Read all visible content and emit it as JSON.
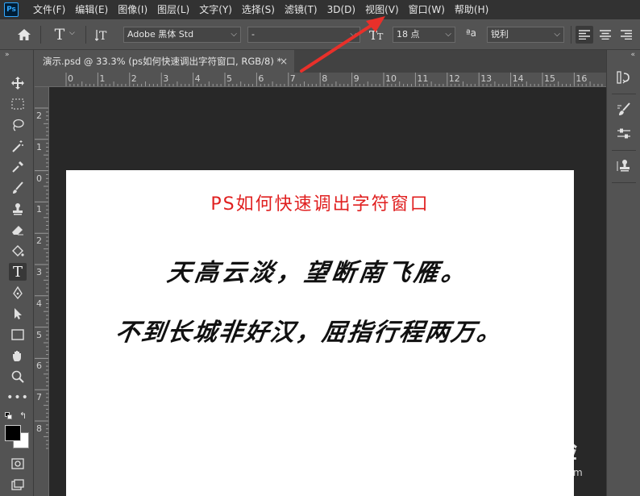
{
  "app": {
    "logo": "Ps"
  },
  "menu": [
    "文件(F)",
    "编辑(E)",
    "图像(I)",
    "图层(L)",
    "文字(Y)",
    "选择(S)",
    "滤镜(T)",
    "3D(D)",
    "视图(V)",
    "窗口(W)",
    "帮助(H)"
  ],
  "options": {
    "font_family": "Adobe 黑体 Std",
    "font_style": "-",
    "font_size": "18 点",
    "aa_label": "ªa",
    "anti_alias": "锐利"
  },
  "tab": {
    "title": "演示.psd @ 33.3% (ps如何快速调出字符窗口, RGB/8) *",
    "close": "×"
  },
  "rulers": {
    "top": [
      "0",
      "1",
      "2",
      "3",
      "4",
      "5",
      "6",
      "7",
      "8",
      "9",
      "10",
      "11",
      "12",
      "13",
      "14",
      "15",
      "16"
    ],
    "left": [
      "2",
      "1",
      "0",
      "1",
      "2",
      "3",
      "4",
      "5",
      "6",
      "7",
      "8"
    ]
  },
  "document": {
    "title": "PS如何快速调出字符窗口",
    "line1": "天高云淡，望断南飞雁。",
    "line2": "不到长城非好汉，屈指行程两万。"
  },
  "watermark": {
    "brand": "Bai经验",
    "url": "jingyan.baidu.com"
  },
  "colors": {
    "title_red": "#e02020",
    "arrow_red": "#e8302a",
    "ps_blue": "#31a8ff"
  },
  "icons": {
    "home": "home-icon",
    "text_tool": "text-tool-icon",
    "orientation": "text-orientation-icon",
    "size": "font-size-icon",
    "align_left": "align-left-icon",
    "align_center": "align-center-icon",
    "align_right": "align-right-icon"
  }
}
